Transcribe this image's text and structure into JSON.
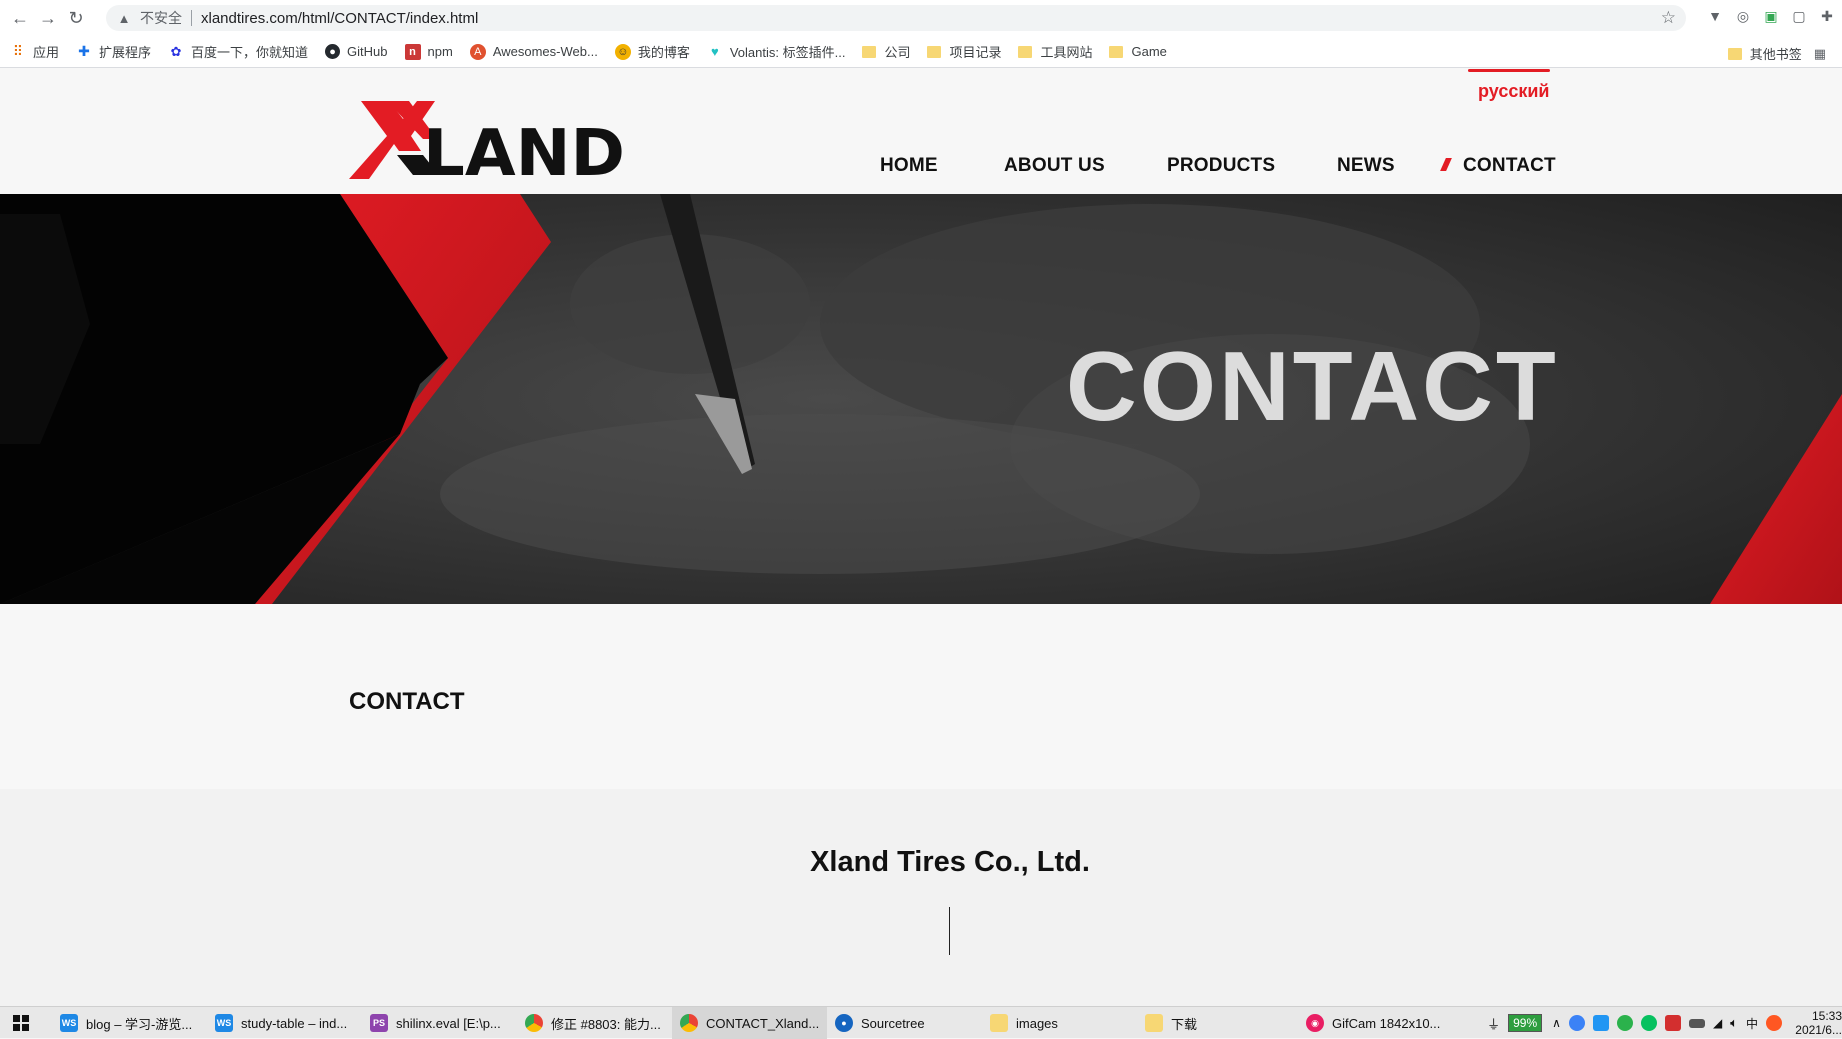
{
  "browser": {
    "insecure_label": "不安全",
    "url": "xlandtires.com/html/CONTACT/index.html",
    "bookmarks": [
      {
        "label": "应用",
        "icon": "apps-grid-icon"
      },
      {
        "label": "扩展程序",
        "icon": "puzzle-icon"
      },
      {
        "label": "百度一下，你就知道",
        "icon": "baidu-paw-icon"
      },
      {
        "label": "GitHub",
        "icon": "github-icon"
      },
      {
        "label": "npm",
        "icon": "npm-icon"
      },
      {
        "label": "Awesomes-Web...",
        "icon": "awesomes-icon"
      },
      {
        "label": "我的博客",
        "icon": "blog-icon"
      },
      {
        "label": "Volantis: 标签插件...",
        "icon": "volantis-icon"
      },
      {
        "label": "公司",
        "icon": "folder-icon"
      },
      {
        "label": "项目记录",
        "icon": "folder-icon"
      },
      {
        "label": "工具网站",
        "icon": "folder-icon"
      },
      {
        "label": "Game",
        "icon": "folder-icon"
      }
    ],
    "other_bookmarks": "其他书签"
  },
  "site": {
    "logo_text": "XLAND",
    "language": "русский",
    "nav": [
      "HOME",
      "ABOUT US",
      "PRODUCTS",
      "NEWS",
      "CONTACT"
    ],
    "active_nav": "CONTACT",
    "hero_title": "CONTACT",
    "section_title": "CONTACT",
    "company_name": "Xland Tires Co., Ltd.",
    "brand_color": "#e31c24"
  },
  "taskbar": {
    "tasks": [
      {
        "label": "blog – 学习-游览...",
        "icon": "webstorm-icon",
        "color": "#1e88e5"
      },
      {
        "label": "study-table – ind...",
        "icon": "webstorm-icon",
        "color": "#1e88e5"
      },
      {
        "label": "shilinx.eval [E:\\p...",
        "icon": "phpstorm-icon",
        "color": "#8e44ad"
      },
      {
        "label": "修正 #8803: 能力...",
        "icon": "chrome-icon",
        "color": "#4caf50"
      },
      {
        "label": "CONTACT_Xland...",
        "icon": "chrome-icon",
        "color": "#4caf50"
      },
      {
        "label": "Sourcetree",
        "icon": "sourcetree-icon",
        "color": "#1565c0"
      },
      {
        "label": "images",
        "icon": "folder-icon",
        "color": "#f7d774"
      },
      {
        "label": "下载",
        "icon": "folder-icon",
        "color": "#f7d774"
      },
      {
        "label": "GifCam 1842x10...",
        "icon": "gifcam-icon",
        "color": "#e91e63"
      }
    ],
    "battery": "99%",
    "time": "15:33",
    "date": "2021/6..."
  }
}
